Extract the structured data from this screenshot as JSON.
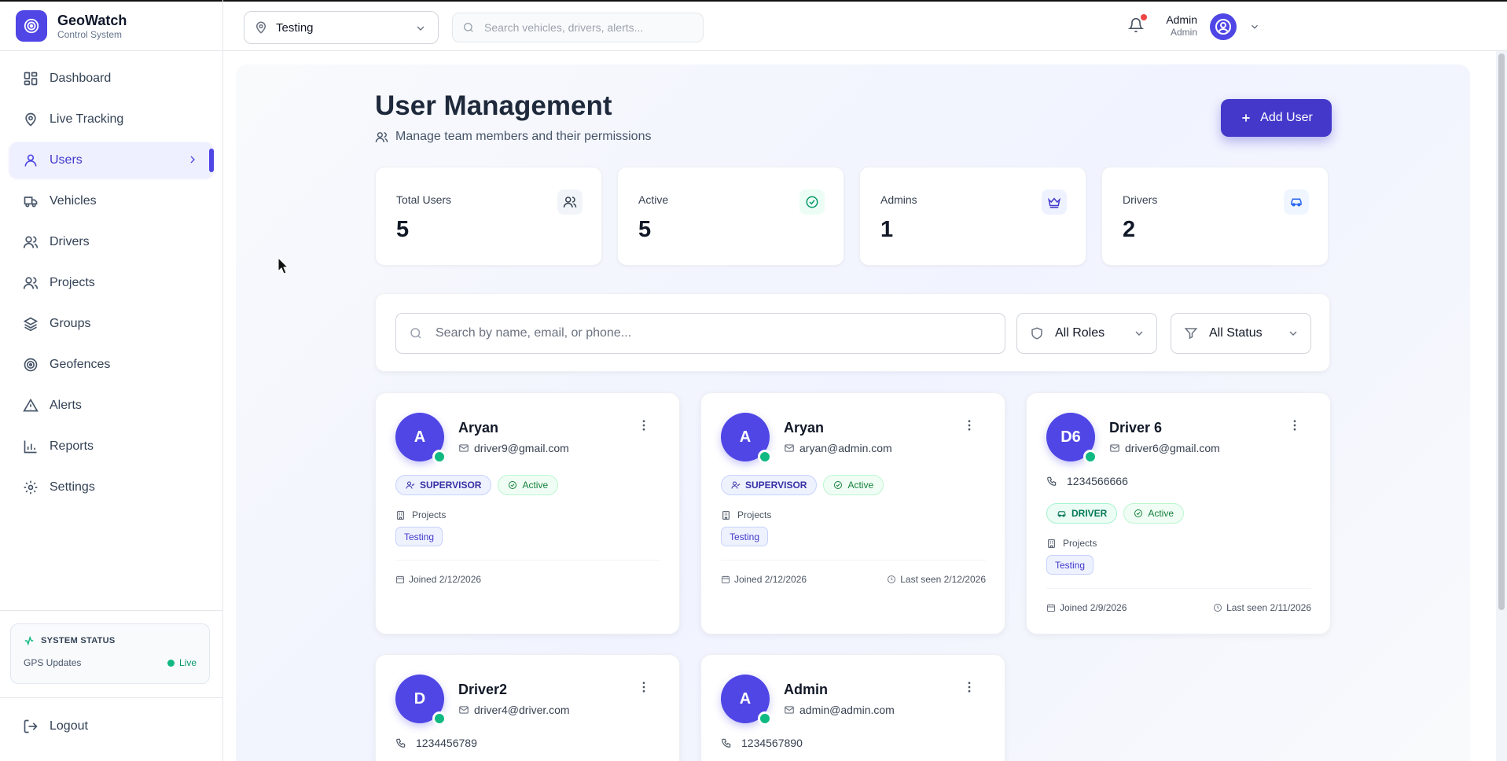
{
  "brand": {
    "name": "GeoWatch",
    "subtitle": "Control System"
  },
  "sidebar": {
    "items": [
      {
        "label": "Dashboard",
        "icon": "dashboard-icon"
      },
      {
        "label": "Live Tracking",
        "icon": "map-pin-icon"
      },
      {
        "label": "Users",
        "icon": "user-icon",
        "active": true
      },
      {
        "label": "Vehicles",
        "icon": "truck-icon"
      },
      {
        "label": "Drivers",
        "icon": "users-icon"
      },
      {
        "label": "Projects",
        "icon": "users-icon"
      },
      {
        "label": "Groups",
        "icon": "layers-icon"
      },
      {
        "label": "Geofences",
        "icon": "target-icon"
      },
      {
        "label": "Alerts",
        "icon": "alert-triangle-icon"
      },
      {
        "label": "Reports",
        "icon": "bar-chart-icon"
      },
      {
        "label": "Settings",
        "icon": "gear-icon"
      }
    ],
    "system_status": {
      "title": "SYSTEM STATUS",
      "label": "GPS Updates",
      "value": "Live"
    },
    "logout_label": "Logout"
  },
  "header": {
    "project_select": "Testing",
    "search_placeholder": "Search vehicles, drivers, alerts...",
    "user": {
      "name": "Admin",
      "role": "Admin"
    }
  },
  "page": {
    "title": "User Management",
    "subtitle": "Manage team members and their permissions",
    "add_button": "Add User"
  },
  "stats": [
    {
      "label": "Total Users",
      "value": "5",
      "icon": "users-icon"
    },
    {
      "label": "Active",
      "value": "5",
      "icon": "check-circle-icon"
    },
    {
      "label": "Admins",
      "value": "1",
      "icon": "crown-icon"
    },
    {
      "label": "Drivers",
      "value": "2",
      "icon": "car-icon"
    }
  ],
  "filters": {
    "search_placeholder": "Search by name, email, or phone...",
    "role_select": "All Roles",
    "status_select": "All Status"
  },
  "users": [
    {
      "initials": "A",
      "name": "Aryan",
      "email": "driver9@gmail.com",
      "phone": "",
      "role": "SUPERVISOR",
      "status": "Active",
      "projects_label": "Projects",
      "project": "Testing",
      "joined": "Joined 2/12/2026",
      "last_seen": ""
    },
    {
      "initials": "A",
      "name": "Aryan",
      "email": "aryan@admin.com",
      "phone": "",
      "role": "SUPERVISOR",
      "status": "Active",
      "projects_label": "Projects",
      "project": "Testing",
      "joined": "Joined 2/12/2026",
      "last_seen": "Last seen 2/12/2026"
    },
    {
      "initials": "D6",
      "name": "Driver 6",
      "email": "driver6@gmail.com",
      "phone": "1234566666",
      "role": "DRIVER",
      "status": "Active",
      "projects_label": "Projects",
      "project": "Testing",
      "joined": "Joined 2/9/2026",
      "last_seen": "Last seen 2/11/2026"
    },
    {
      "initials": "D",
      "name": "Driver2",
      "email": "driver4@driver.com",
      "phone": "1234456789"
    },
    {
      "initials": "A",
      "name": "Admin",
      "email": "admin@admin.com",
      "phone": "1234567890"
    }
  ],
  "colors": {
    "primary": "#4f46e5",
    "primary_dark": "#4338ca",
    "online": "#10b981",
    "alert_dot": "#ef4444"
  }
}
